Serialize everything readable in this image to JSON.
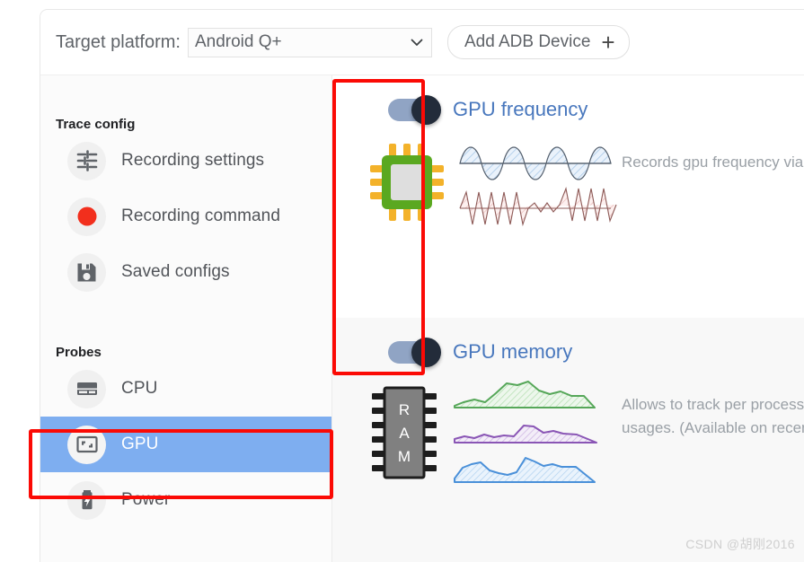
{
  "header": {
    "platform_label": "Target platform:",
    "platform_value": "Android Q+",
    "platform_options": [
      "Android Q+"
    ],
    "add_device_label": "Add ADB Device",
    "add_device_plus": "+",
    "chevron_icon": "chevron-down-icon"
  },
  "sidebar": {
    "trace_config_title": "Trace config",
    "probes_title": "Probes",
    "trace_config_items": [
      {
        "label": "Recording settings",
        "icon": "tune-icon",
        "selected": false
      },
      {
        "label": "Recording command",
        "icon": "record-dot-icon",
        "selected": false
      },
      {
        "label": "Saved configs",
        "icon": "save-floppy-icon",
        "selected": false
      }
    ],
    "probe_items": [
      {
        "label": "CPU",
        "icon": "cpu-chip-icon",
        "selected": false
      },
      {
        "label": "GPU",
        "icon": "gpu-screen-icon",
        "selected": true
      },
      {
        "label": "Power",
        "icon": "battery-bolt-icon",
        "selected": false
      }
    ]
  },
  "probes": [
    {
      "title": "GPU frequency",
      "toggle_state": "on",
      "description": "Records gpu frequency via ftra",
      "illustration": "gpu-chip-waveform-illustration"
    },
    {
      "title": "GPU memory",
      "toggle_state": "on",
      "description_line1": "Allows to track per process an",
      "description_line2": "usages. (Available on recent A",
      "illustration": "ram-chip-area-charts-illustration"
    }
  ],
  "annotations": {
    "toggles_box": "red-highlight-box-toggles",
    "gpu_box": "red-highlight-box-gpu-item"
  },
  "watermark": "CSDN @胡刚2016",
  "colors": {
    "accent_blue": "#4877bd",
    "selected_row": "#7eaef0",
    "annotation_red": "#fb0a05",
    "toggle_track": "#90a4c4",
    "toggle_knob": "#232c3a"
  }
}
